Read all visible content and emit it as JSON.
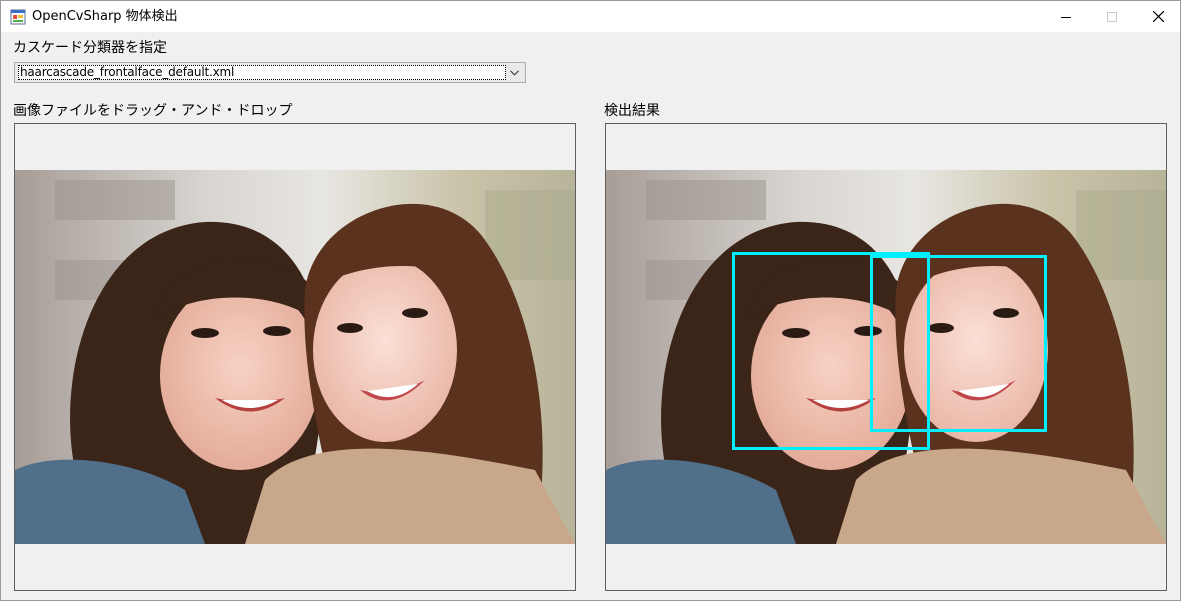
{
  "window": {
    "title": "OpenCvSharp 物体検出",
    "icon": "winforms-app-icon",
    "controls": [
      "minimize-icon",
      "maximize-icon",
      "close-icon"
    ]
  },
  "classifier": {
    "label": "カスケード分類器を指定",
    "selected": "haarcascade_frontalface_default.xml"
  },
  "source_panel": {
    "label": "画像ファイルをドラッグ・アンド・ドロップ",
    "image": "photo of two smiling women cheek to cheek"
  },
  "result_panel": {
    "label": "検出結果",
    "image": "same photo with detected faces outlined",
    "box_color": "#00f0ff"
  }
}
